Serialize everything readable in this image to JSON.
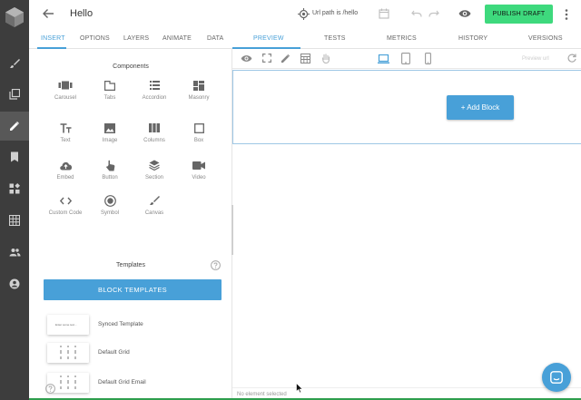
{
  "header": {
    "title": "Hello",
    "url_path": "Url path is /hello",
    "publish_label": "PUBLISH DRAFT"
  },
  "left_tabs": [
    {
      "label": "INSERT"
    },
    {
      "label": "OPTIONS"
    },
    {
      "label": "LAYERS"
    },
    {
      "label": "ANIMATE"
    },
    {
      "label": "DATA"
    }
  ],
  "right_tabs": [
    {
      "label": "PREVIEW"
    },
    {
      "label": "TESTS"
    },
    {
      "label": "METRICS"
    },
    {
      "label": "HISTORY"
    },
    {
      "label": "VERSIONS"
    }
  ],
  "preview": {
    "url_placeholder": "Preview url",
    "add_block_label": "+ Add Block",
    "status": "No element selected"
  },
  "components": {
    "heading": "Components",
    "items": [
      {
        "label": "Carousel",
        "icon": "carousel-icon"
      },
      {
        "label": "Tabs",
        "icon": "tabs-icon"
      },
      {
        "label": "Accordion",
        "icon": "accordion-icon"
      },
      {
        "label": "Masonry",
        "icon": "masonry-icon"
      },
      {
        "label": "Text",
        "icon": "text-icon"
      },
      {
        "label": "Image",
        "icon": "image-icon"
      },
      {
        "label": "Columns",
        "icon": "columns-icon"
      },
      {
        "label": "Box",
        "icon": "box-icon"
      },
      {
        "label": "Embed",
        "icon": "embed-icon"
      },
      {
        "label": "Button",
        "icon": "button-icon"
      },
      {
        "label": "Section",
        "icon": "section-icon"
      },
      {
        "label": "Video",
        "icon": "video-icon"
      },
      {
        "label": "Custom Code",
        "icon": "code-icon"
      },
      {
        "label": "Symbol",
        "icon": "symbol-icon"
      },
      {
        "label": "Canvas",
        "icon": "canvas-icon"
      }
    ]
  },
  "templates": {
    "heading": "Templates",
    "button_label": "BLOCK TEMPLATES",
    "items": [
      {
        "name": "Synced Template",
        "thumb_text": "Enter some text..."
      },
      {
        "name": "Default Grid"
      },
      {
        "name": "Default Grid Email"
      }
    ]
  },
  "colors": {
    "accent": "#48a0d8",
    "publish": "#3ed97d",
    "rail": "#3d3d3d"
  }
}
